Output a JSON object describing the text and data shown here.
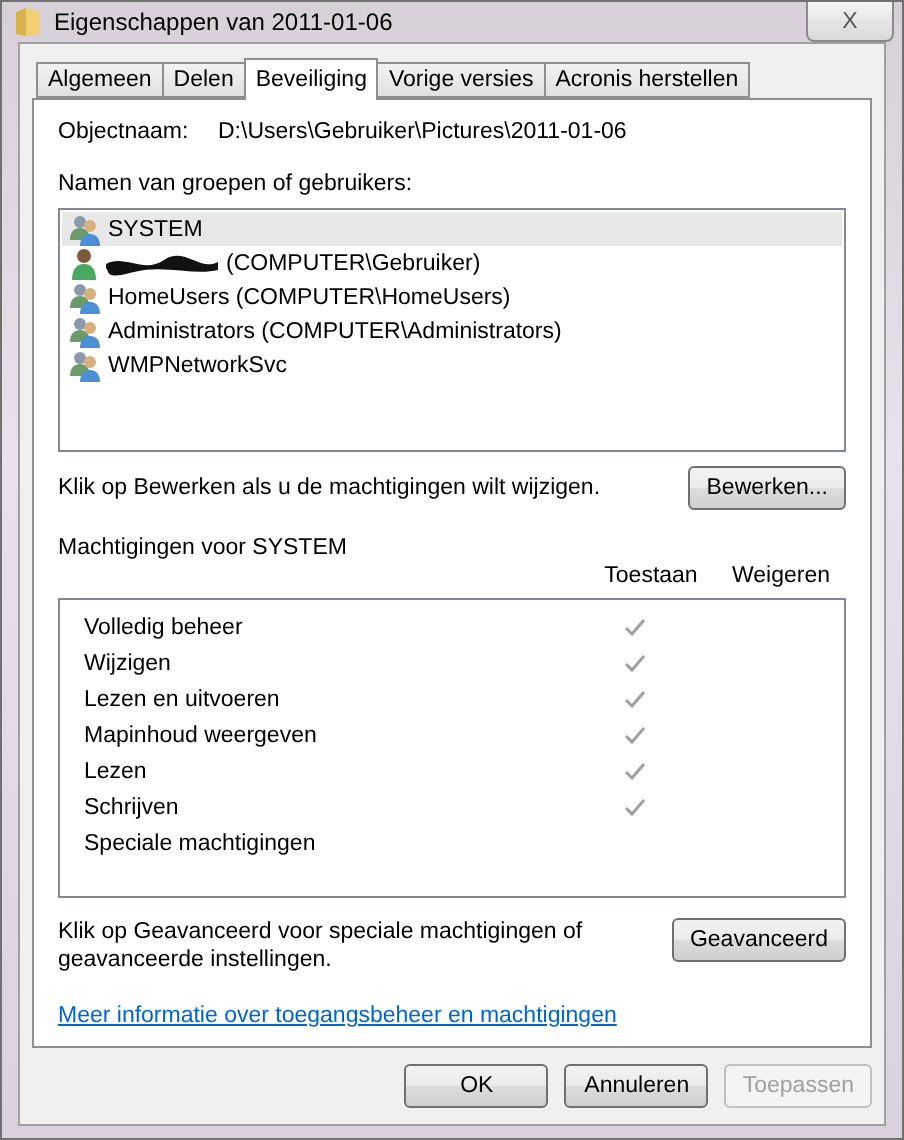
{
  "window": {
    "title": "Eigenschappen van 2011-01-06",
    "close": "X"
  },
  "tabs": [
    {
      "label": "Algemeen",
      "selected": false
    },
    {
      "label": "Delen",
      "selected": false
    },
    {
      "label": "Beveiliging",
      "selected": true
    },
    {
      "label": "Vorige versies",
      "selected": false
    },
    {
      "label": "Acronis herstellen",
      "selected": false
    }
  ],
  "object": {
    "label": "Objectnaam:",
    "value": "D:\\Users\\Gebruiker\\Pictures\\2011-01-06"
  },
  "users_label": "Namen van groepen of gebruikers:",
  "users": [
    {
      "kind": "group",
      "name": "SYSTEM",
      "selected": true,
      "redacted": false
    },
    {
      "kind": "user",
      "name": "(COMPUTER\\Gebruiker)",
      "selected": false,
      "redacted": true
    },
    {
      "kind": "group",
      "name": "HomeUsers (COMPUTER\\HomeUsers)",
      "selected": false,
      "redacted": false
    },
    {
      "kind": "group",
      "name": "Administrators (COMPUTER\\Administrators)",
      "selected": false,
      "redacted": false
    },
    {
      "kind": "group",
      "name": "WMPNetworkSvc",
      "selected": false,
      "redacted": false
    }
  ],
  "edit_hint": "Klik op Bewerken als u de machtigingen wilt wijzigen.",
  "edit_button": "Bewerken...",
  "permissions_label": "Machtigingen voor SYSTEM",
  "columns": [
    "Toestaan",
    "Weigeren"
  ],
  "permissions": [
    {
      "name": "Volledig beheer",
      "allow": true,
      "deny": false
    },
    {
      "name": "Wijzigen",
      "allow": true,
      "deny": false
    },
    {
      "name": "Lezen en uitvoeren",
      "allow": true,
      "deny": false
    },
    {
      "name": "Mapinhoud weergeven",
      "allow": true,
      "deny": false
    },
    {
      "name": "Lezen",
      "allow": true,
      "deny": false
    },
    {
      "name": "Schrijven",
      "allow": true,
      "deny": false
    },
    {
      "name": "Speciale machtigingen",
      "allow": false,
      "deny": false
    }
  ],
  "advanced_hint": "Klik op Geavanceerd voor speciale machtigingen of geavanceerde instellingen.",
  "advanced_button": "Geavanceerd",
  "link": "Meer informatie over toegangsbeheer en machtigingen",
  "buttons": [
    {
      "label": "OK",
      "disabled": false
    },
    {
      "label": "Annuleren",
      "disabled": false
    },
    {
      "label": "Toepassen",
      "disabled": true
    }
  ]
}
